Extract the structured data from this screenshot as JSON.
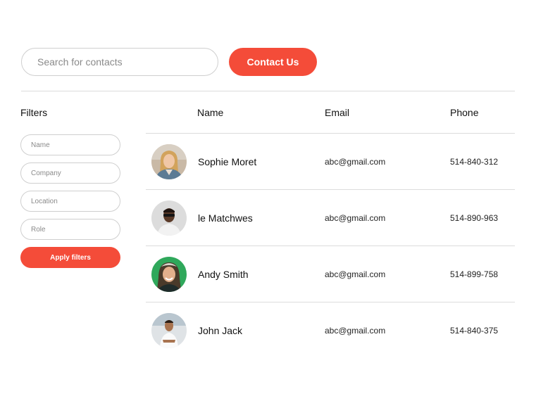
{
  "header": {
    "search_placeholder": "Search for contacts",
    "contact_button_label": "Contact Us"
  },
  "filters": {
    "title": "Filters",
    "fields": [
      {
        "placeholder": "Name"
      },
      {
        "placeholder": "Company"
      },
      {
        "placeholder": "Location"
      },
      {
        "placeholder": "Role"
      }
    ],
    "apply_label": "Apply filters"
  },
  "table": {
    "columns": [
      "Name",
      "Email",
      "Phone"
    ],
    "rows": [
      {
        "name": "Sophie Moret",
        "email": "abc@gmail.com",
        "phone": "514-840-312",
        "avatar": "avatar-photo"
      },
      {
        "name": "le Matchwes",
        "email": "abc@gmail.com",
        "phone": "514-890-963",
        "avatar": "avatar-photo"
      },
      {
        "name": "Andy Smith",
        "email": "abc@gmail.com",
        "phone": "514-899-758",
        "avatar": "avatar-photo"
      },
      {
        "name": "John Jack",
        "email": "abc@gmail.com",
        "phone": "514-840-375",
        "avatar": "avatar-photo"
      }
    ]
  },
  "colors": {
    "accent": "#f44c39",
    "border": "#cfcfcf",
    "divider": "#dcdcdc"
  }
}
